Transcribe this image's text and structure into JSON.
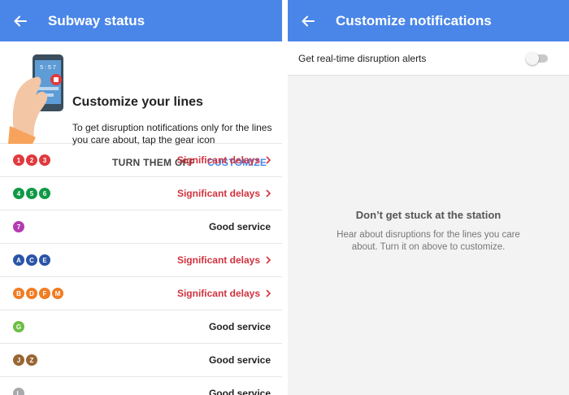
{
  "left": {
    "title": "Subway status",
    "promo": {
      "heading": "Customize your lines",
      "description": "To get disruption notifications only for the lines you care about, tap the gear icon",
      "phone_screen_text": "5 : 5 7",
      "turn_off_label": "TURN THEM OFF",
      "customize_label": "CUSTOMIZE"
    },
    "lines": [
      {
        "bullets": [
          {
            "t": "1",
            "c": "#e03a3e"
          },
          {
            "t": "2",
            "c": "#e03a3e"
          },
          {
            "t": "3",
            "c": "#e03a3e"
          }
        ],
        "status": "Significant delays",
        "kind": "delay"
      },
      {
        "bullets": [
          {
            "t": "4",
            "c": "#0f9a46"
          },
          {
            "t": "5",
            "c": "#0f9a46"
          },
          {
            "t": "6",
            "c": "#0f9a46"
          }
        ],
        "status": "Significant delays",
        "kind": "delay"
      },
      {
        "bullets": [
          {
            "t": "7",
            "c": "#b43bb0"
          }
        ],
        "status": "Good service",
        "kind": "good"
      },
      {
        "bullets": [
          {
            "t": "A",
            "c": "#2a54a8"
          },
          {
            "t": "C",
            "c": "#2a54a8"
          },
          {
            "t": "E",
            "c": "#2a54a8"
          }
        ],
        "status": "Significant delays",
        "kind": "delay"
      },
      {
        "bullets": [
          {
            "t": "B",
            "c": "#f07c24"
          },
          {
            "t": "D",
            "c": "#f07c24"
          },
          {
            "t": "F",
            "c": "#f07c24"
          },
          {
            "t": "M",
            "c": "#f07c24"
          }
        ],
        "status": "Significant delays",
        "kind": "delay"
      },
      {
        "bullets": [
          {
            "t": "G",
            "c": "#6cbe45"
          }
        ],
        "status": "Good service",
        "kind": "good"
      },
      {
        "bullets": [
          {
            "t": "J",
            "c": "#996633"
          },
          {
            "t": "Z",
            "c": "#996633"
          }
        ],
        "status": "Good service",
        "kind": "good"
      },
      {
        "bullets": [
          {
            "t": "L",
            "c": "#a7a9ac"
          }
        ],
        "status": "Good service",
        "kind": "good"
      }
    ]
  },
  "right": {
    "title": "Customize notifications",
    "toggle_label": "Get real-time disruption alerts",
    "toggle_on": false,
    "empty_title": "Don’t get stuck at the station",
    "empty_text": "Hear about disruptions for the lines you care about. Turn it on above to customize."
  },
  "colors": {
    "appbar": "#4a86e8",
    "delay": "#d2323d",
    "accent": "#4a86e8"
  },
  "icons": [
    "back-arrow-icon",
    "chevron-right-icon",
    "phone-hand-illustration"
  ]
}
